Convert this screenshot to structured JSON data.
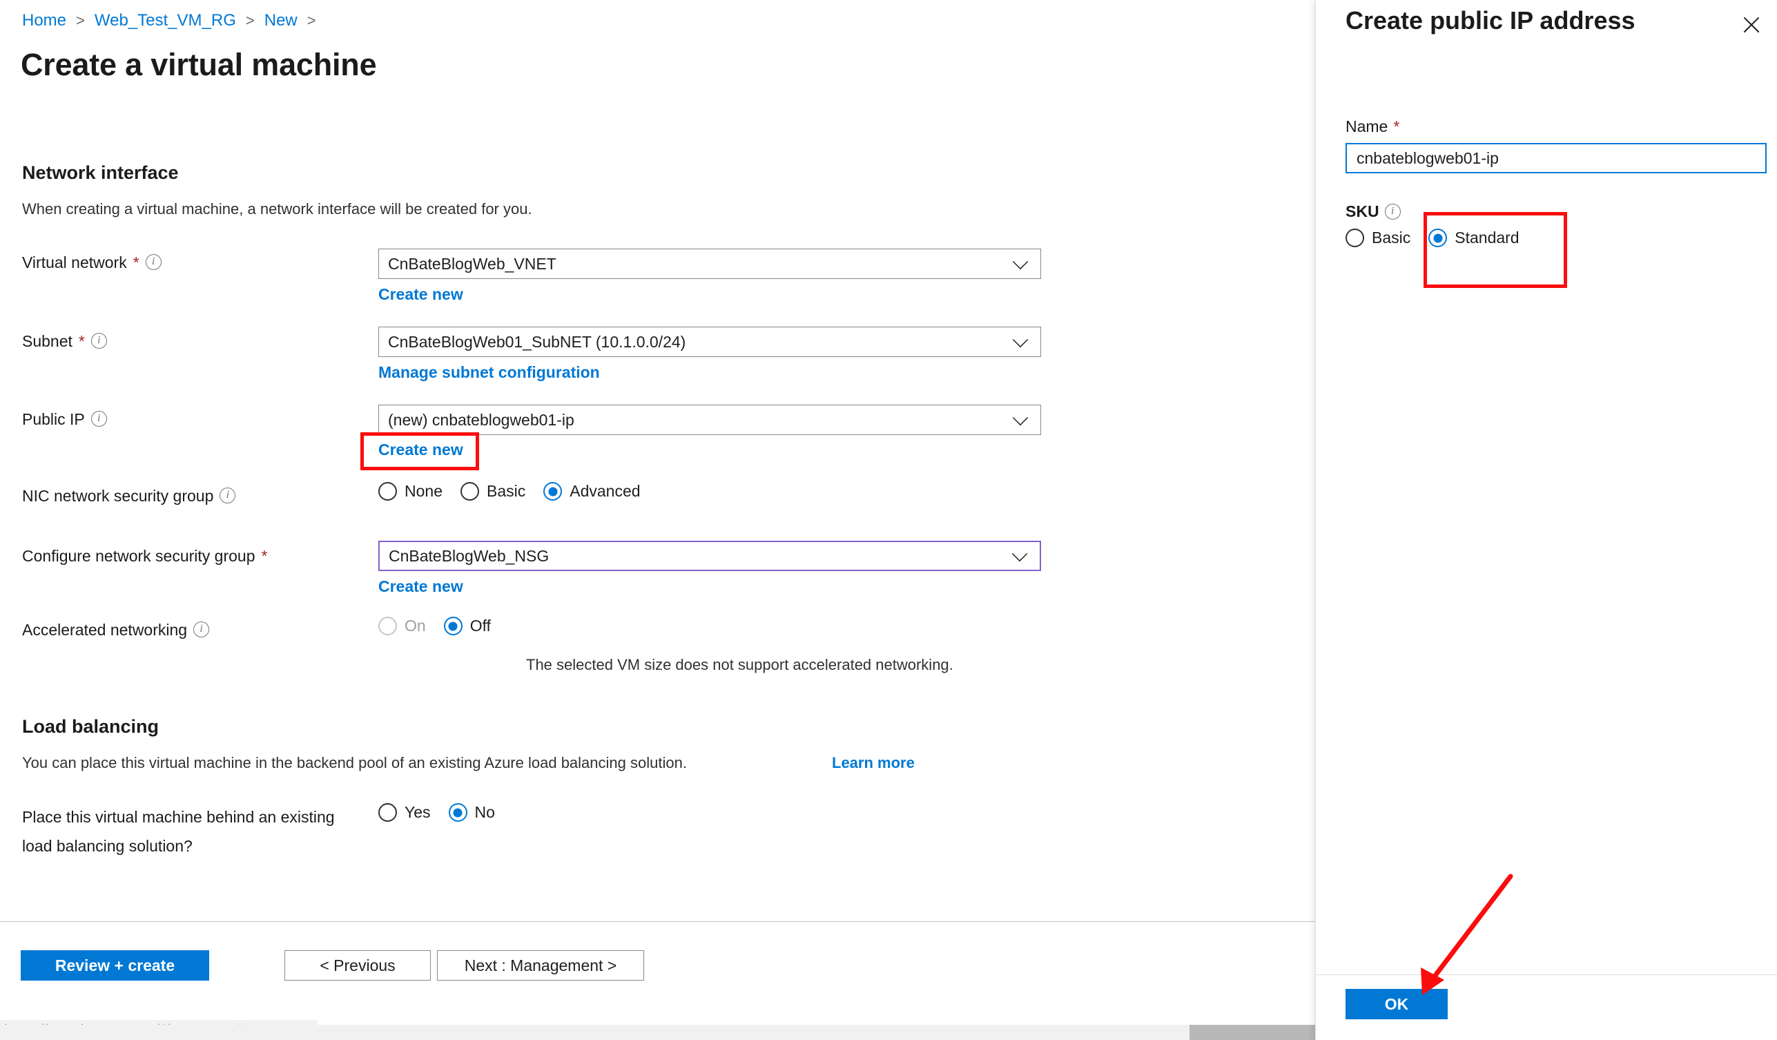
{
  "breadcrumb": {
    "items": [
      "Home",
      "Web_Test_VM_RG",
      "New"
    ],
    "separator": ">"
  },
  "page": {
    "title": "Create a virtual machine"
  },
  "network_interface": {
    "heading": "Network interface",
    "description": "When creating a virtual machine, a network interface will be created for you.",
    "virtual_network": {
      "label": "Virtual network",
      "required_marker": "*",
      "value": "CnBateBlogWeb_VNET",
      "create_new_link": "Create new"
    },
    "subnet": {
      "label": "Subnet",
      "required_marker": "*",
      "value": "CnBateBlogWeb01_SubNET (10.1.0.0/24)",
      "manage_link": "Manage subnet configuration"
    },
    "public_ip": {
      "label": "Public IP",
      "value": "(new) cnbateblogweb01-ip",
      "create_new_link": "Create new"
    },
    "nic_nsg": {
      "label": "NIC network security group",
      "options": [
        "None",
        "Basic",
        "Advanced"
      ],
      "selected": "Advanced"
    },
    "configure_nsg": {
      "label": "Configure network security group",
      "required_marker": "*",
      "value": "CnBateBlogWeb_NSG",
      "create_new_link": "Create new"
    },
    "accelerated_networking": {
      "label": "Accelerated networking",
      "options": [
        "On",
        "Off"
      ],
      "selected": "Off",
      "disabled_options": [
        "On"
      ],
      "note": "The selected VM size does not support accelerated networking."
    }
  },
  "load_balancing": {
    "heading": "Load balancing",
    "description": "You can place this virtual machine in the backend pool of an existing Azure load balancing solution.",
    "learn_more_link": "Learn more",
    "question": {
      "label": "Place this virtual machine behind an existing load balancing solution?",
      "options": [
        "Yes",
        "No"
      ],
      "selected": "No"
    }
  },
  "footer": {
    "review_create": "Review + create",
    "previous": "< Previous",
    "next": "Next : Management >"
  },
  "statusbar": {
    "url": "https://portal.azure.com/?l=en.en-us#"
  },
  "panel": {
    "title": "Create public IP address",
    "close_label": "Close",
    "name": {
      "label": "Name",
      "required_marker": "*",
      "value": "cnbateblogweb01-ip"
    },
    "sku": {
      "label": "SKU",
      "options": [
        "Basic",
        "Standard"
      ],
      "selected": "Standard"
    },
    "ok_button": "OK"
  },
  "colors": {
    "accent_blue": "#0078d4",
    "link_blue": "#0078d4",
    "annotation_red": "#fb0d0d",
    "required_red": "#a4262c",
    "focus_purple": "#8661c5"
  }
}
